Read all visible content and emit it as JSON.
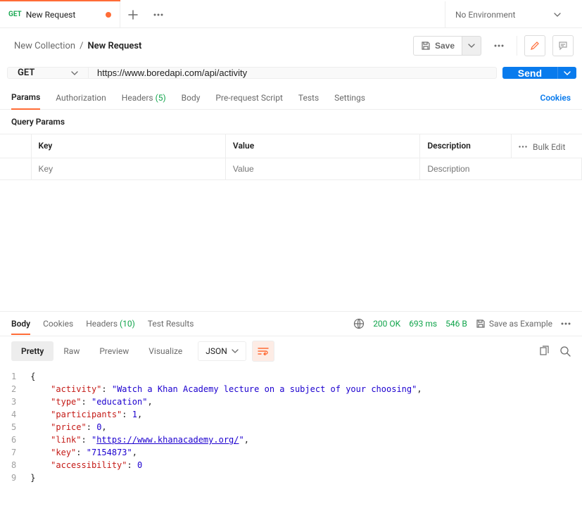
{
  "tab": {
    "method": "GET",
    "title": "New Request"
  },
  "env": {
    "label": "No Environment"
  },
  "breadcrumb": {
    "collection": "New Collection",
    "sep": "/",
    "request": "New Request"
  },
  "actions": {
    "save": "Save"
  },
  "request": {
    "method": "GET",
    "url": "https://www.boredapi.com/api/activity",
    "send": "Send"
  },
  "reqTabs": {
    "params": "Params",
    "authorization": "Authorization",
    "headers": "Headers",
    "headersCount": "(5)",
    "body": "Body",
    "preReq": "Pre-request Script",
    "tests": "Tests",
    "settings": "Settings",
    "cookies": "Cookies"
  },
  "querySection": {
    "title": "Query Params"
  },
  "paramsTable": {
    "headers": {
      "key": "Key",
      "value": "Value",
      "description": "Description",
      "bulkEdit": "Bulk Edit"
    },
    "placeholders": {
      "key": "Key",
      "value": "Value",
      "description": "Description"
    }
  },
  "resTabs": {
    "body": "Body",
    "cookies": "Cookies",
    "headers": "Headers",
    "headersCount": "(10)",
    "tests": "Test Results"
  },
  "status": {
    "code": "200 OK",
    "time": "693 ms",
    "size": "546 B",
    "saveExample": "Save as Example"
  },
  "viewer": {
    "pretty": "Pretty",
    "raw": "Raw",
    "preview": "Preview",
    "visualize": "Visualize",
    "format": "JSON"
  },
  "responseBody": {
    "activity": "Watch a Khan Academy lecture on a subject of your choosing",
    "type": "education",
    "participants": 1,
    "price": 0,
    "link": "https://www.khanacademy.org/",
    "key": "7154873",
    "accessibility": 0
  }
}
